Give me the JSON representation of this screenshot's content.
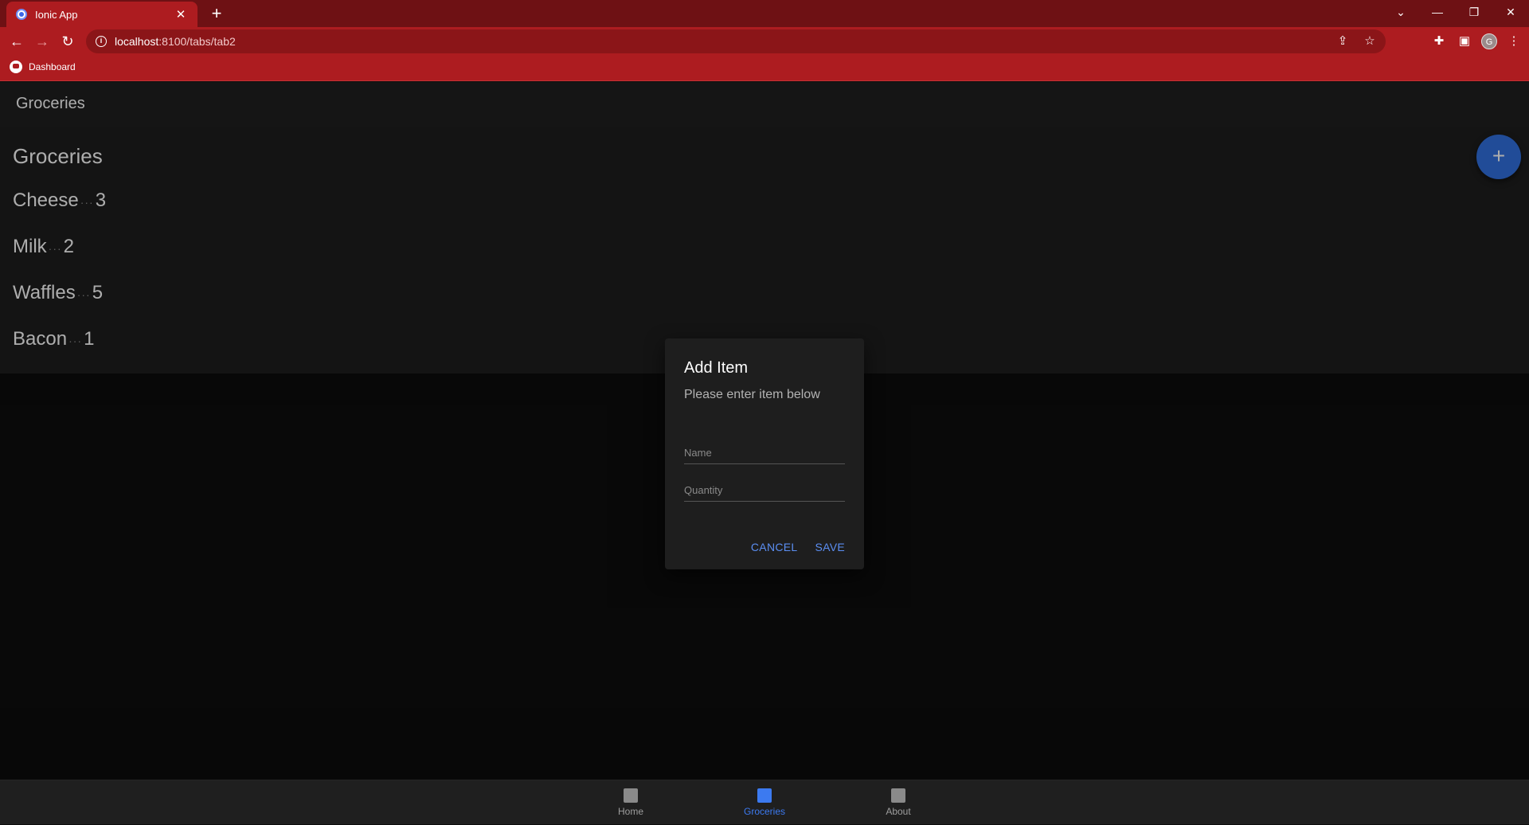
{
  "browser": {
    "tab_title": "Ionic App",
    "tab_close": "✕",
    "new_tab": "+",
    "window_controls": {
      "dropdown": "⌄",
      "minimize": "—",
      "restore": "❐",
      "close": "✕"
    },
    "url_host": "localhost",
    "url_path": ":8100/tabs/tab2",
    "bookmark_label": "Dashboard",
    "avatar_letter": "G"
  },
  "app": {
    "header_title": "Groceries",
    "list_heading": "Groceries",
    "items": [
      {
        "name": "Cheese",
        "separator": "···",
        "quantity": "3"
      },
      {
        "name": "Milk",
        "separator": "···",
        "quantity": "2"
      },
      {
        "name": "Waffles",
        "separator": "···",
        "quantity": "5"
      },
      {
        "name": "Bacon",
        "separator": "···",
        "quantity": "1"
      }
    ],
    "fab_label": "+"
  },
  "dialog": {
    "title": "Add Item",
    "message": "Please enter item below",
    "name_placeholder": "Name",
    "quantity_placeholder": "Quantity",
    "cancel_label": "CANCEL",
    "save_label": "SAVE"
  },
  "tabs": [
    {
      "label": "Home",
      "active": false
    },
    {
      "label": "Groceries",
      "active": true
    },
    {
      "label": "About",
      "active": false
    }
  ],
  "colors": {
    "accent": "#3171e0",
    "tab_active": "#3c7af0",
    "tab_inactive": "#9e9e9e",
    "chrome": "#ad1c20"
  }
}
